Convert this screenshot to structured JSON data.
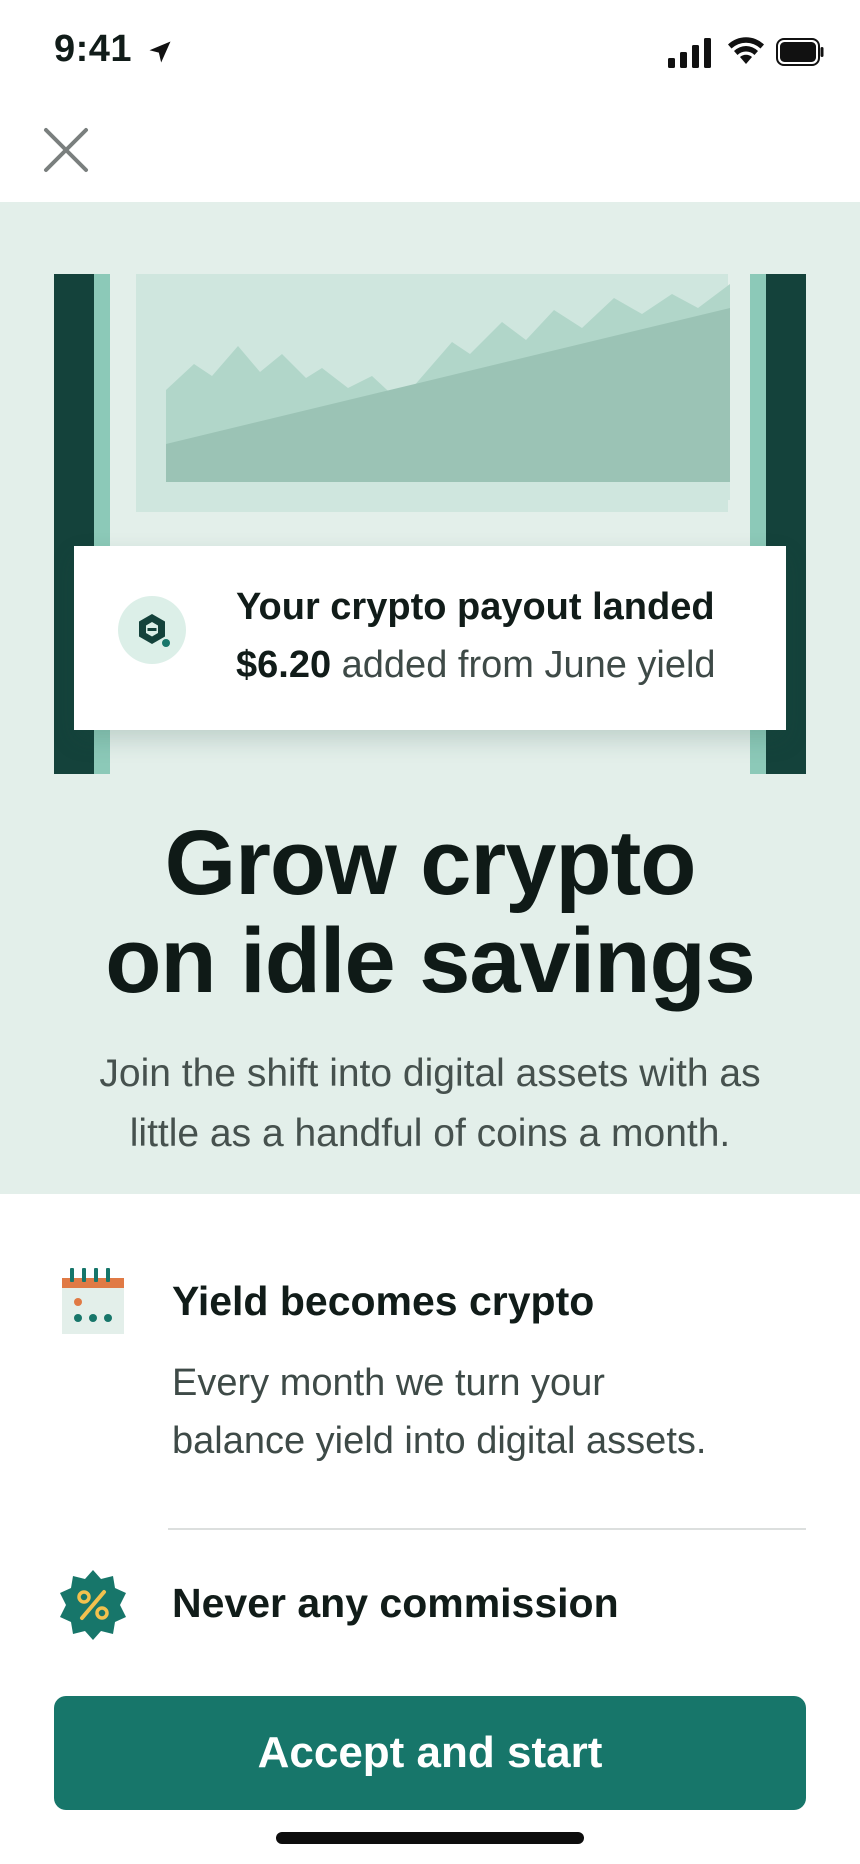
{
  "status_bar": {
    "time": "9:41"
  },
  "notification": {
    "title": "Your crypto payout landed",
    "amount": "$6.20",
    "detail": "added from June yield"
  },
  "hero": {
    "title_lines": [
      "Grow crypto",
      "on idle savings"
    ],
    "subtitle_lines": [
      "Join the shift into digital assets with as",
      "little as a handful of coins a month."
    ]
  },
  "features": [
    {
      "icon": "calendar-icon",
      "title": "Yield becomes crypto",
      "description_lines": [
        "Every month we turn your",
        "balance yield into digital assets."
      ]
    },
    {
      "icon": "percent-badge-icon",
      "title": "Never any commission"
    }
  ],
  "cta": {
    "label": "Accept and start"
  },
  "colors": {
    "hero_background": "#e3efea",
    "primary": "#17766a",
    "dark_teal": "#14423b",
    "accent_orange": "#e07a45"
  }
}
